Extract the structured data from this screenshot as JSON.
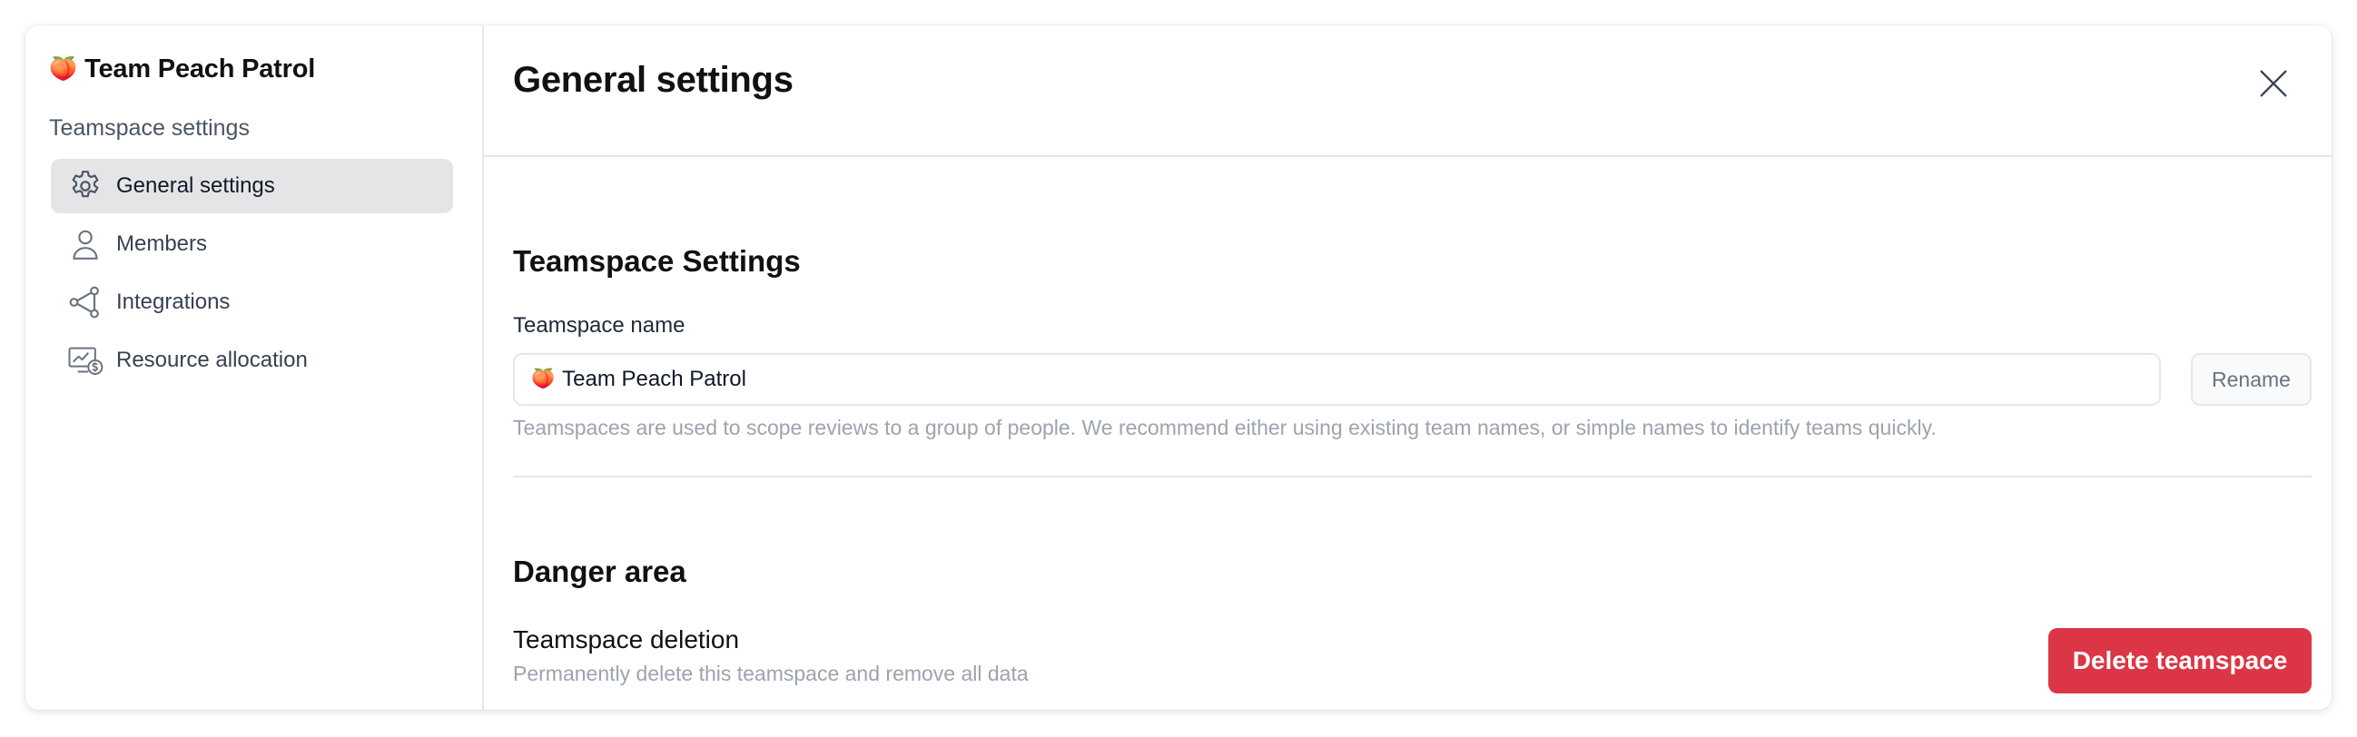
{
  "sidebar": {
    "team_emoji": "🍑",
    "team_name": "Team Peach Patrol",
    "heading": "Teamspace settings",
    "items": [
      {
        "label": "General settings",
        "icon": "gear-icon",
        "active": true
      },
      {
        "label": "Members",
        "icon": "user-icon",
        "active": false
      },
      {
        "label": "Integrations",
        "icon": "share-nodes-icon",
        "active": false
      },
      {
        "label": "Resource allocation",
        "icon": "monitor-dollar-icon",
        "active": false
      }
    ]
  },
  "main": {
    "title": "General settings",
    "close_icon": "close-icon",
    "settings_section": {
      "title": "Teamspace Settings",
      "name_label": "Teamspace name",
      "name_emoji": "🍑",
      "name_value": "Team Peach Patrol",
      "rename_label": "Rename",
      "helper": "Teamspaces are used to scope reviews to a group of people. We recommend either using existing team names, or simple names to identify teams quickly."
    },
    "danger_section": {
      "title": "Danger area",
      "deletion_label": "Teamspace deletion",
      "deletion_desc": "Permanently delete this teamspace and remove all data",
      "delete_label": "Delete teamspace"
    }
  },
  "colors": {
    "danger": "#dc3545",
    "active_nav_bg": "#e5e5e7",
    "border": "#e5e7eb",
    "muted_text": "#9ca3af"
  }
}
